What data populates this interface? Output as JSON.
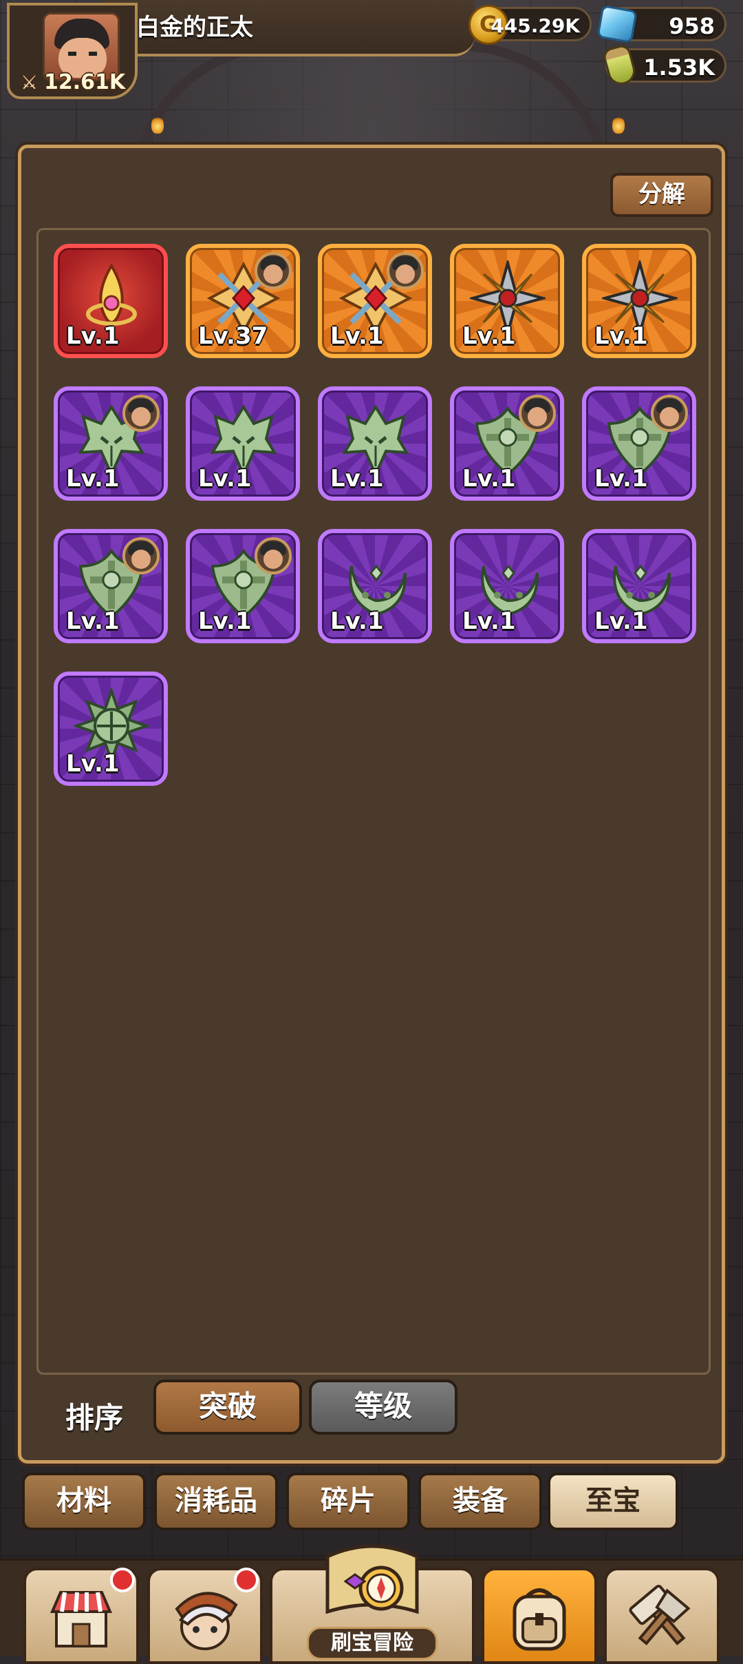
{
  "header": {
    "player_name": "白金的正太",
    "power": "12.61K",
    "gold": "445.29K",
    "gems": "958",
    "potion": "1.53K"
  },
  "panel": {
    "decompose_label": "分解",
    "items": [
      {
        "level": "Lv.1",
        "rarity": "red",
        "icon": "flame-charm-icon",
        "owner": false
      },
      {
        "level": "Lv.37",
        "rarity": "orange",
        "icon": "ruby-cross-emblem-icon",
        "owner": true
      },
      {
        "level": "Lv.1",
        "rarity": "orange",
        "icon": "ruby-cross-emblem-icon",
        "owner": true
      },
      {
        "level": "Lv.1",
        "rarity": "orange",
        "icon": "steel-shuriken-icon",
        "owner": false
      },
      {
        "level": "Lv.1",
        "rarity": "orange",
        "icon": "steel-shuriken-icon",
        "owner": false
      },
      {
        "level": "Lv.1",
        "rarity": "purple",
        "icon": "jade-mask-icon",
        "owner": true
      },
      {
        "level": "Lv.1",
        "rarity": "purple",
        "icon": "jade-mask-icon",
        "owner": false
      },
      {
        "level": "Lv.1",
        "rarity": "purple",
        "icon": "jade-mask-icon",
        "owner": false
      },
      {
        "level": "Lv.1",
        "rarity": "purple",
        "icon": "jade-cross-shield-icon",
        "owner": true
      },
      {
        "level": "Lv.1",
        "rarity": "purple",
        "icon": "jade-cross-shield-icon",
        "owner": true
      },
      {
        "level": "Lv.1",
        "rarity": "purple",
        "icon": "jade-cross-shield-icon",
        "owner": true
      },
      {
        "level": "Lv.1",
        "rarity": "purple",
        "icon": "jade-cross-shield-icon",
        "owner": true
      },
      {
        "level": "Lv.1",
        "rarity": "purple",
        "icon": "jade-crescent-icon",
        "owner": false
      },
      {
        "level": "Lv.1",
        "rarity": "purple",
        "icon": "jade-crescent-icon",
        "owner": false
      },
      {
        "level": "Lv.1",
        "rarity": "purple",
        "icon": "jade-crescent-icon",
        "owner": false
      },
      {
        "level": "Lv.1",
        "rarity": "purple",
        "icon": "jade-spiked-mace-icon",
        "owner": false
      }
    ]
  },
  "sort": {
    "label": "排序",
    "options": [
      "突破",
      "等级"
    ],
    "selected": "突破"
  },
  "categories": {
    "tabs": [
      "材料",
      "消耗品",
      "碎片",
      "装备",
      "至宝"
    ],
    "selected": "至宝"
  },
  "bottom_nav": {
    "adventure_label": "刷宝冒险",
    "items": [
      "shop-icon",
      "hero-icon",
      "adventure-map-icon",
      "backpack-icon",
      "forge-icon"
    ],
    "selected": "backpack-icon"
  },
  "colors": {
    "panel_bg": "#4a3a2b",
    "panel_border": "#c99b5e",
    "rarity_red": "#ff5050",
    "rarity_orange": "#ffb040",
    "rarity_purple": "#c07aff"
  }
}
